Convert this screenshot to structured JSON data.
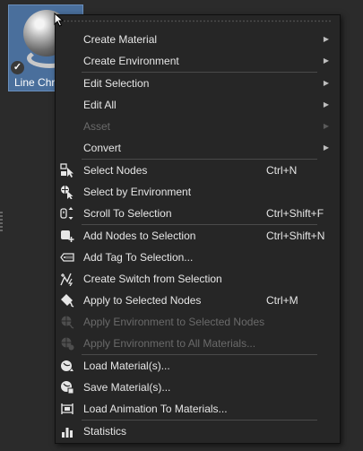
{
  "thumbnail": {
    "label": "Line Chr",
    "check": "✓"
  },
  "menu": {
    "items": [
      {
        "label": "Create Material",
        "submenu": "▶"
      },
      {
        "label": "Create Environment",
        "submenu": "▶"
      },
      {
        "label": "Edit Selection",
        "submenu": "▶"
      },
      {
        "label": "Edit All",
        "submenu": "▶"
      },
      {
        "label": "Asset",
        "submenu": "▶"
      },
      {
        "label": "Convert",
        "submenu": "▶"
      },
      {
        "label": "Select Nodes",
        "shortcut": "Ctrl+N",
        "icon": "select-nodes-icon"
      },
      {
        "label": "Select by Environment",
        "icon": "select-by-environment-icon"
      },
      {
        "label": "Scroll To Selection",
        "shortcut": "Ctrl+Shift+F",
        "icon": "scroll-to-selection-icon"
      },
      {
        "label": "Add Nodes to Selection",
        "shortcut": "Ctrl+Shift+N",
        "icon": "add-nodes-icon"
      },
      {
        "label": "Add Tag To Selection...",
        "icon": "tag-icon"
      },
      {
        "label": "Create Switch from Selection",
        "icon": "switch-icon"
      },
      {
        "label": "Apply to Selected Nodes",
        "shortcut": "Ctrl+M",
        "icon": "apply-nodes-icon"
      },
      {
        "label": "Apply Environment to Selected Nodes",
        "icon": "apply-environment-icon"
      },
      {
        "label": "Apply Environment to All Materials...",
        "icon": "apply-environment-all-icon"
      },
      {
        "label": "Load Material(s)...",
        "icon": "load-material-icon"
      },
      {
        "label": "Save Material(s)...",
        "icon": "save-material-icon"
      },
      {
        "label": "Load Animation To Materials...",
        "icon": "load-animation-icon"
      },
      {
        "label": "Statistics",
        "icon": "statistics-icon"
      }
    ]
  }
}
